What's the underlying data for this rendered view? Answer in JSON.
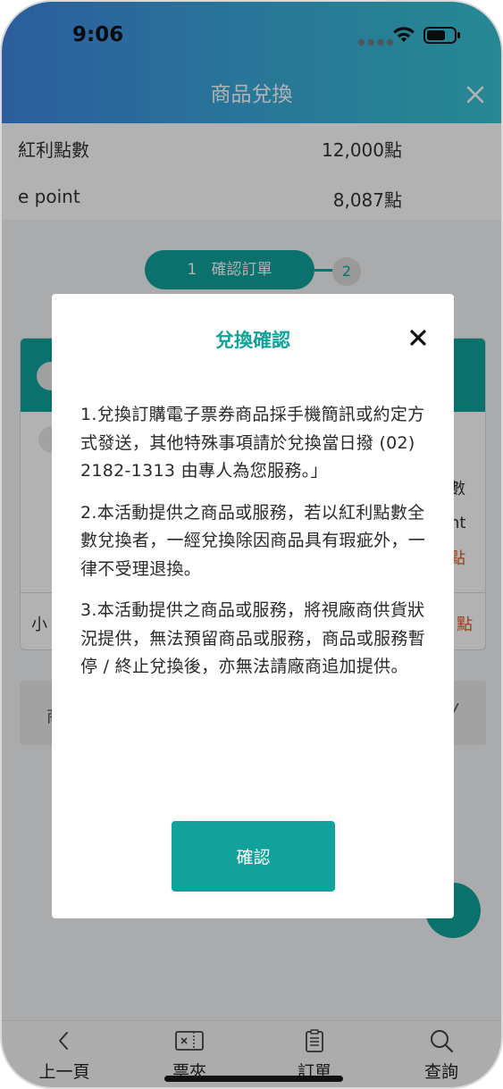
{
  "status_bar": {
    "time": "9:06"
  },
  "header": {
    "title": "商品兌換"
  },
  "points": [
    {
      "label": "紅利點數",
      "value": "12,000點"
    },
    {
      "label": "e point",
      "value": "8,087點"
    }
  ],
  "stepper": {
    "step1_number": "1",
    "step1_label": "確認訂單",
    "step2_number": "2"
  },
  "background_fragments": {
    "card_right_1": "數",
    "card_right_2": "nt",
    "card_right_3": "點",
    "subtotal_left": "小",
    "subtotal_right": "點",
    "bar_left": "商",
    "bar_right": "╱"
  },
  "modal": {
    "title": "兌換確認",
    "paragraphs": [
      "1.兌換訂購電子票券商品採手機簡訊或約定方式發送，其他特殊事項請於兌換當日撥 (02) 2182-1313 由專人為您服務。」",
      "2.本活動提供之商品或服務，若以紅利點數全數兌換者，一經兌換除因商品具有瑕疵外，一律不受理退換。",
      "3.本活動提供之商品或服務，將視廠商供貨狀況提供，無法預留商品或服務，商品或服務暫停 / 終止兌換後，亦無法請廠商追加提供。"
    ],
    "confirm_label": "確認"
  },
  "bottom_nav": [
    {
      "label": "上一頁",
      "icon": "chevron-left-icon"
    },
    {
      "label": "票夾",
      "icon": "ticket-icon"
    },
    {
      "label": "訂單",
      "icon": "clipboard-icon"
    },
    {
      "label": "查詢",
      "icon": "search-icon"
    }
  ],
  "colors": {
    "accent": "#11a39b",
    "header_gradient_start": "#3f86e2",
    "header_gradient_end": "#38c3d3",
    "highlight_orange": "#e05a1e"
  }
}
